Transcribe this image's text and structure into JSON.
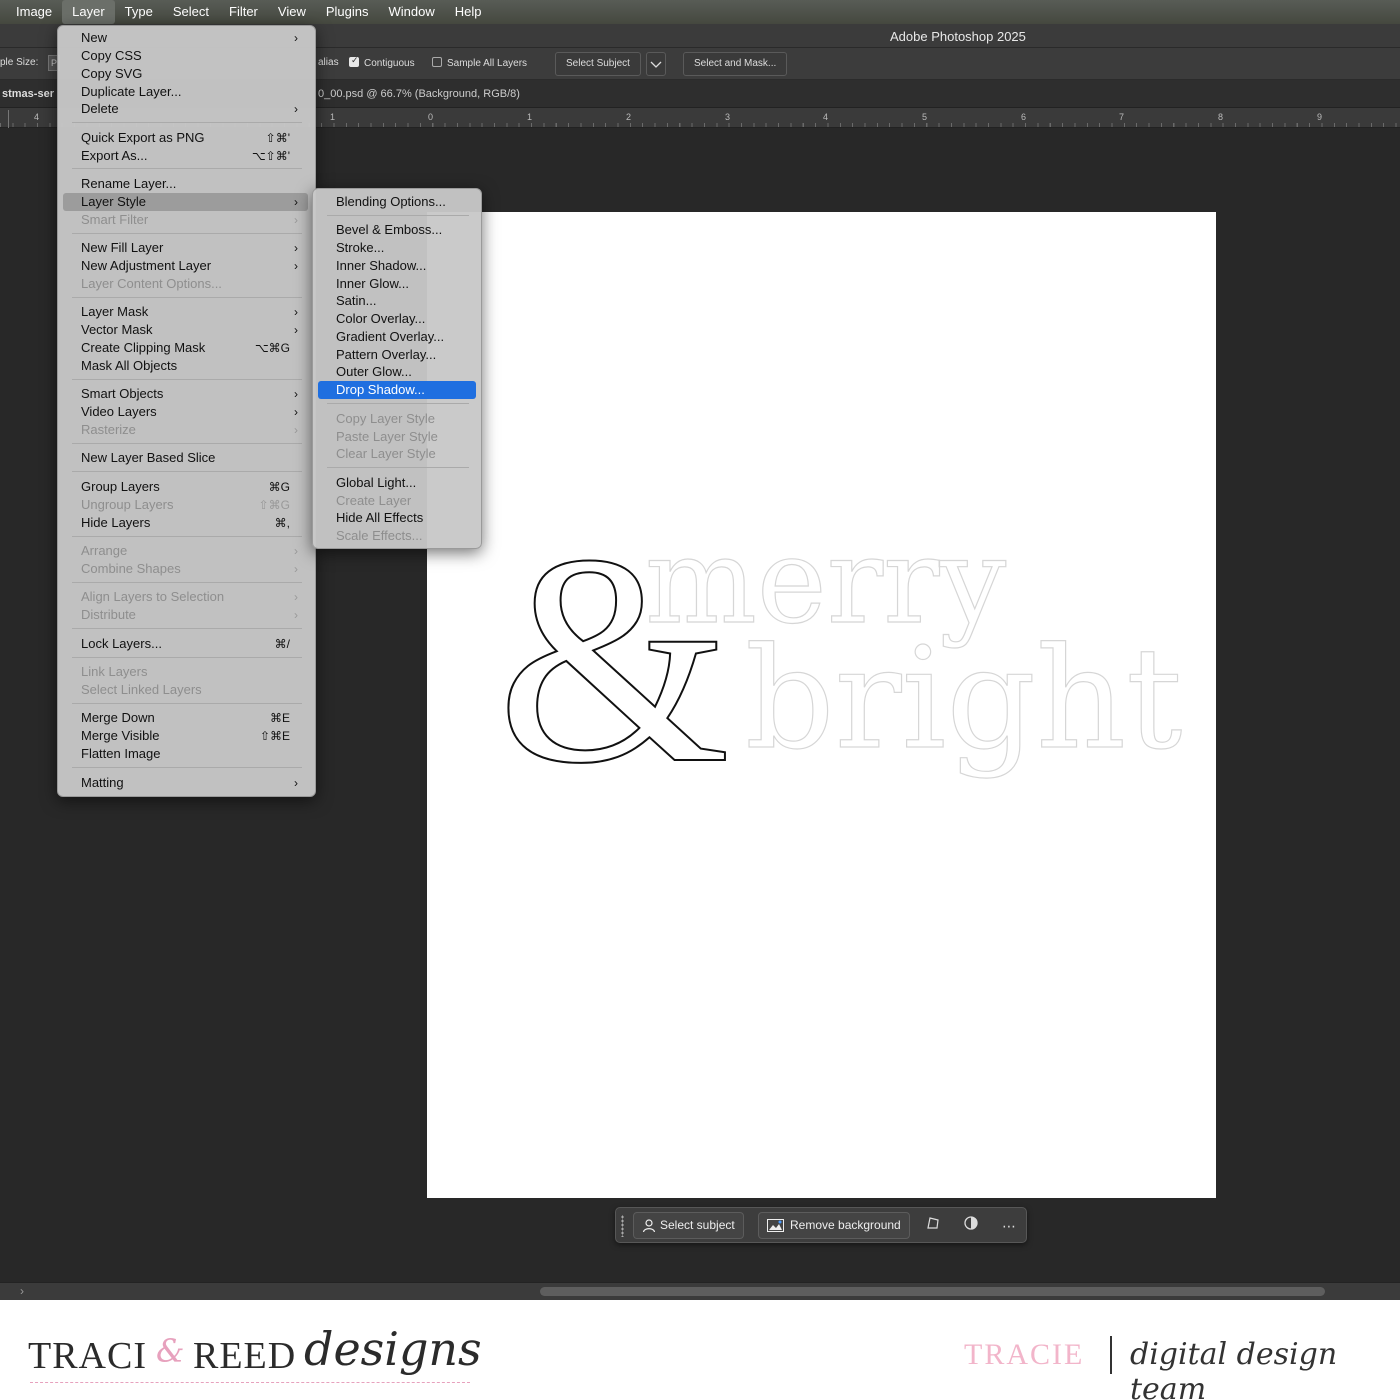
{
  "menubar": {
    "items": [
      "Image",
      "Layer",
      "Type",
      "Select",
      "Filter",
      "View",
      "Plugins",
      "Window",
      "Help"
    ],
    "active": "Layer"
  },
  "titlebar": {
    "title": "Adobe Photoshop 2025"
  },
  "optionsbar": {
    "sample_size_label": "ple Size:",
    "sample_size_value": "P",
    "antialias_label": "alias",
    "contiguous_label": "Contiguous",
    "contiguous_checked": true,
    "sample_all_label": "Sample All Layers",
    "sample_all_checked": false,
    "select_subject_label": "Select Subject",
    "select_and_mask_label": "Select and Mask..."
  },
  "tabbar": {
    "tab_name": "stmas-ser",
    "doc_title": "0_00.psd @ 66.7% (Background, RGB/8)"
  },
  "ruler": {
    "labels": [
      "4",
      "1",
      "0",
      "1",
      "2",
      "3",
      "4",
      "5",
      "6",
      "7",
      "8",
      "9"
    ]
  },
  "layer_menu": {
    "items": [
      {
        "label": "New",
        "submenu": true
      },
      {
        "label": "Copy CSS"
      },
      {
        "label": "Copy SVG"
      },
      {
        "label": "Duplicate Layer..."
      },
      {
        "label": "Delete",
        "submenu": true
      },
      {
        "label": "Quick Export as PNG",
        "shortcut": "⇧⌘'"
      },
      {
        "label": "Export As...",
        "shortcut": "⌥⇧⌘'"
      },
      {
        "label": "Rename Layer..."
      },
      {
        "label": "Layer Style",
        "submenu": true,
        "highlighted": true
      },
      {
        "label": "Smart Filter",
        "submenu": true,
        "disabled": true
      },
      {
        "label": "New Fill Layer",
        "submenu": true
      },
      {
        "label": "New Adjustment Layer",
        "submenu": true
      },
      {
        "label": "Layer Content Options...",
        "disabled": true
      },
      {
        "label": "Layer Mask",
        "submenu": true
      },
      {
        "label": "Vector Mask",
        "submenu": true
      },
      {
        "label": "Create Clipping Mask",
        "shortcut": "⌥⌘G"
      },
      {
        "label": "Mask All Objects"
      },
      {
        "label": "Smart Objects",
        "submenu": true
      },
      {
        "label": "Video Layers",
        "submenu": true
      },
      {
        "label": "Rasterize",
        "submenu": true,
        "disabled": true
      },
      {
        "label": "New Layer Based Slice"
      },
      {
        "label": "Group Layers",
        "shortcut": "⌘G"
      },
      {
        "label": "Ungroup Layers",
        "shortcut": "⇧⌘G",
        "disabled": true
      },
      {
        "label": "Hide Layers",
        "shortcut": "⌘,"
      },
      {
        "label": "Arrange",
        "submenu": true,
        "disabled": true
      },
      {
        "label": "Combine Shapes",
        "submenu": true,
        "disabled": true
      },
      {
        "label": "Align Layers to Selection",
        "submenu": true,
        "disabled": true
      },
      {
        "label": "Distribute",
        "submenu": true,
        "disabled": true
      },
      {
        "label": "Lock Layers...",
        "shortcut": "⌘/"
      },
      {
        "label": "Link Layers",
        "disabled": true
      },
      {
        "label": "Select Linked Layers",
        "disabled": true
      },
      {
        "label": "Merge Down",
        "shortcut": "⌘E"
      },
      {
        "label": "Merge Visible",
        "shortcut": "⇧⌘E"
      },
      {
        "label": "Flatten Image"
      },
      {
        "label": "Matting",
        "submenu": true
      }
    ]
  },
  "style_menu": {
    "items": [
      {
        "label": "Blending Options..."
      },
      {
        "label": "Bevel & Emboss..."
      },
      {
        "label": "Stroke..."
      },
      {
        "label": "Inner Shadow..."
      },
      {
        "label": "Inner Glow..."
      },
      {
        "label": "Satin..."
      },
      {
        "label": "Color Overlay..."
      },
      {
        "label": "Gradient Overlay..."
      },
      {
        "label": "Pattern Overlay..."
      },
      {
        "label": "Outer Glow..."
      },
      {
        "label": "Drop Shadow...",
        "selected": true
      },
      {
        "label": "Copy Layer Style",
        "disabled": true
      },
      {
        "label": "Paste Layer Style",
        "disabled": true
      },
      {
        "label": "Clear Layer Style",
        "disabled": true
      },
      {
        "label": "Global Light..."
      },
      {
        "label": "Create Layer",
        "disabled": true
      },
      {
        "label": "Hide All Effects"
      },
      {
        "label": "Scale Effects...",
        "disabled": true
      }
    ]
  },
  "canvas": {
    "artwork_words": [
      "merry",
      "&",
      "bright"
    ]
  },
  "taskbar": {
    "select_subject_label": "Select subject",
    "remove_background_label": "Remove background"
  },
  "footer": {
    "logo_text": "TRACI REED designs",
    "member_name": "TRACIE",
    "team_label": "digital design team"
  },
  "colors": {
    "menu_selected": "#1f6fe0",
    "workspace": "#282828",
    "brand_pink": "#f2b5ca"
  }
}
